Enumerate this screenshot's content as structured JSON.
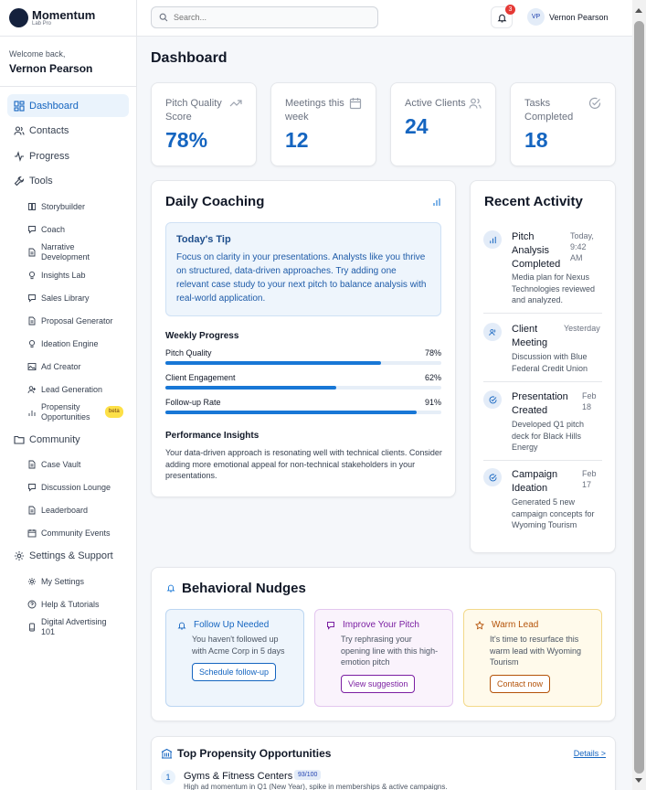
{
  "app": {
    "name": "Momentum",
    "sub": "Lab Pro"
  },
  "welcome": {
    "greeting": "Welcome back,",
    "name": "Vernon Pearson"
  },
  "nav": {
    "dashboard": "Dashboard",
    "contacts": "Contacts",
    "progress": "Progress",
    "tools": "Tools",
    "tools_items": [
      "Storybuilder",
      "Coach",
      "Narrative Development",
      "Insights Lab",
      "Sales Library",
      "Proposal Generator",
      "Ideation Engine",
      "Ad Creator",
      "Lead Generation",
      "Propensity Opportunities"
    ],
    "beta": "beta",
    "community": "Community",
    "community_items": [
      "Case Vault",
      "Discussion Lounge",
      "Leaderboard",
      "Community Events"
    ],
    "settings": "Settings & Support",
    "settings_items": [
      "My Settings",
      "Help & Tutorials",
      "Digital Advertising 101"
    ]
  },
  "topbar": {
    "search_placeholder": "Search...",
    "notifications": "3",
    "user_initials": "VP",
    "user_name": "Vernon Pearson"
  },
  "page_title": "Dashboard",
  "stats": [
    {
      "label": "Pitch Quality Score",
      "value": "78%",
      "icon": "trending-up-icon"
    },
    {
      "label": "Meetings this week",
      "value": "12",
      "icon": "calendar-icon"
    },
    {
      "label": "Active Clients",
      "value": "24",
      "icon": "users-icon"
    },
    {
      "label": "Tasks Completed",
      "value": "18",
      "icon": "check-circle-icon"
    }
  ],
  "coaching": {
    "title": "Daily Coaching",
    "tip_title": "Today's Tip",
    "tip_text": "Focus on clarity in your presentations. Analysts like you thrive on structured, data-driven approaches. Try adding one relevant case study to your next pitch to balance analysis with real-world application.",
    "weekly_title": "Weekly Progress",
    "progress": [
      {
        "label": "Pitch Quality",
        "value": "78%",
        "fraction": 0.78
      },
      {
        "label": "Client Engagement",
        "value": "62%",
        "fraction": 0.62
      },
      {
        "label": "Follow-up Rate",
        "value": "91%",
        "fraction": 0.91
      }
    ],
    "insights_title": "Performance Insights",
    "insights_text": "Your data-driven approach is resonating well with technical clients. Consider adding more emotional appeal for non-technical stakeholders in your presentations."
  },
  "activity": {
    "title": "Recent Activity",
    "items": [
      {
        "title": "Pitch Analysis Completed",
        "time": "Today, 9:42 AM",
        "desc": "Media plan for Nexus Technologies reviewed and analyzed."
      },
      {
        "title": "Client Meeting",
        "time": "Yesterday",
        "desc": "Discussion with Blue Federal Credit Union"
      },
      {
        "title": "Presentation Created",
        "time": "Feb 18",
        "desc": "Developed Q1 pitch deck for Black Hills Energy"
      },
      {
        "title": "Campaign Ideation",
        "time": "Feb 17",
        "desc": "Generated 5 new campaign concepts for Wyoming Tourism"
      }
    ]
  },
  "nudges": {
    "title": "Behavioral Nudges",
    "items": [
      {
        "title": "Follow Up Needed",
        "text": "You haven't followed up with Acme Corp in 5 days",
        "button": "Schedule follow-up"
      },
      {
        "title": "Improve Your Pitch",
        "text": "Try rephrasing your opening line with this high-emotion pitch",
        "button": "View suggestion"
      },
      {
        "title": "Warm Lead",
        "text": "It's time to resurface this warm lead with Wyoming Tourism",
        "button": "Contact now"
      }
    ]
  },
  "opportunities": {
    "title": "Top Propensity Opportunities",
    "details": "Details >",
    "items": [
      {
        "rank": "1",
        "name": "Gyms & Fitness Centers",
        "score": "93/100",
        "desc": "High ad momentum in Q1 (New Year), spike in memberships & active campaigns."
      }
    ]
  },
  "colors": {
    "accent": "#1565c0",
    "bar": "#1877d6",
    "badge": "#e53935"
  }
}
